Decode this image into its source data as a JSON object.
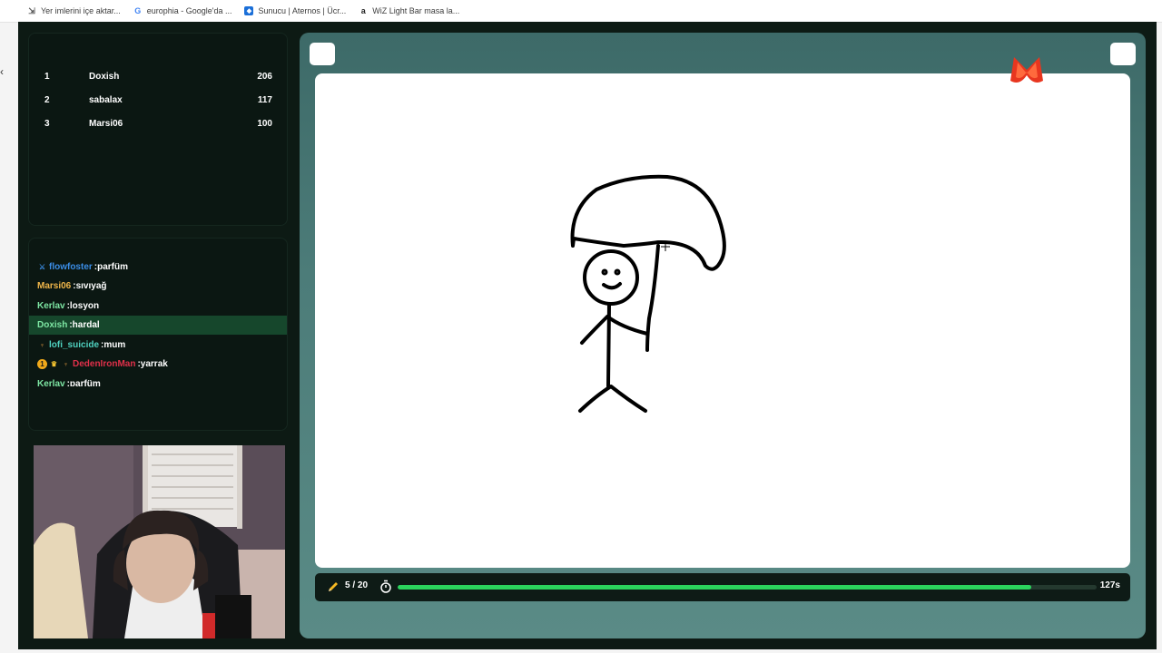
{
  "bookmarks": [
    {
      "label": "Yer imlerini içe aktar...",
      "icon": "import-icon"
    },
    {
      "label": "europhia - Google'da ...",
      "icon": "google-icon"
    },
    {
      "label": "Sunucu | Aternos | Ücr...",
      "icon": "aternos-icon"
    },
    {
      "label": "WiZ Light Bar masa la...",
      "icon": "amazon-icon"
    }
  ],
  "leaderboard": [
    {
      "rank": "1",
      "name": "Doxish",
      "score": "206"
    },
    {
      "rank": "2",
      "name": "sabalax",
      "score": "117"
    },
    {
      "rank": "3",
      "name": "Marsi06",
      "score": "100"
    }
  ],
  "chat": [
    {
      "user": "flowfoster",
      "message": ":parfüm",
      "color": "#3b8de6"
    },
    {
      "user": "Marsi06",
      "message": ":sıvıyağ",
      "color": "#f0b64a"
    },
    {
      "user": "Kerlav",
      "message": ":losyon",
      "color": "#7ee7a4"
    },
    {
      "user": "Doxish",
      "message": ":hardal",
      "color": "#7ee7a4"
    },
    {
      "user": "lofi_suicide",
      "message": ":mum",
      "color": "#4fd2c0"
    },
    {
      "user": "DedenIronMan",
      "message": ":yarrak",
      "color": "#e0304a"
    },
    {
      "user": "Kerlav",
      "message": ":parfüm",
      "color": "#7ee7a4"
    }
  ],
  "badges": {
    "one": "1"
  },
  "game": {
    "round": "5 / 20",
    "time_left": "127s",
    "time_progress": 0.907
  },
  "colors": {
    "accent_green": "#2bd45d",
    "panel_bg": "#0b1712",
    "highlight": "#16472c"
  }
}
